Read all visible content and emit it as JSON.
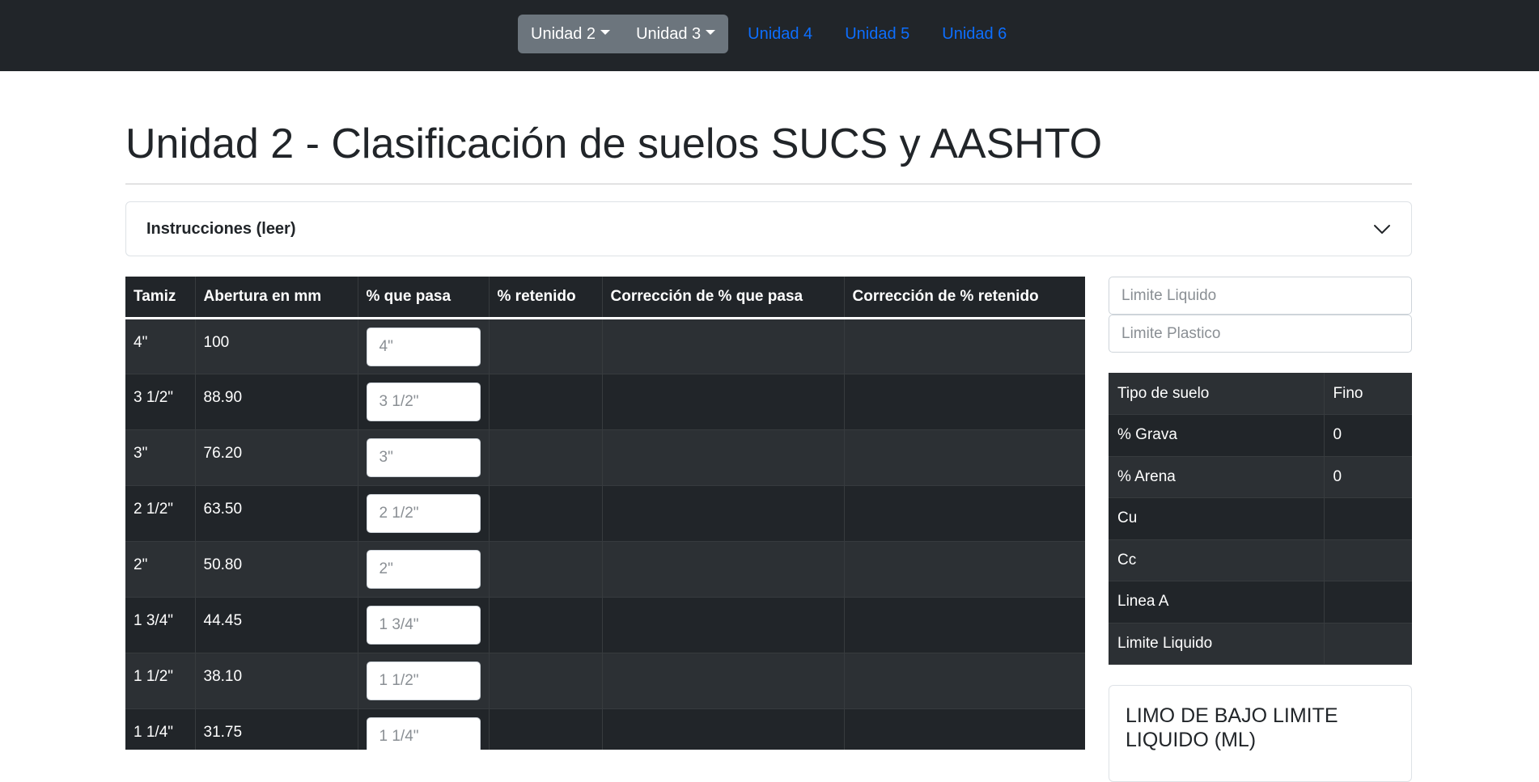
{
  "navbar": {
    "dropdowns": [
      {
        "label": "Unidad 2"
      },
      {
        "label": "Unidad 3"
      }
    ],
    "links": [
      {
        "label": "Unidad 4"
      },
      {
        "label": "Unidad 5"
      },
      {
        "label": "Unidad 6"
      }
    ],
    "colors": {
      "background": "#212529",
      "dropdown": "#6c757d",
      "link": "#0d6efd"
    }
  },
  "page": {
    "title": "Unidad 2 - Clasificación de suelos SUCS y AASHTO"
  },
  "accordion": {
    "label": "Instrucciones (leer)",
    "icon": "chevron-down-icon"
  },
  "sieve_table": {
    "headers": [
      "Tamiz",
      "Abertura en mm",
      "% que pasa",
      "% retenido",
      "Corrección de % que pasa",
      "Corrección de % retenido"
    ],
    "rows": [
      {
        "tamiz": "4\"",
        "abertura": "100",
        "placeholder": "4\"",
        "retenido": "",
        "corr_pasa": "",
        "corr_retenido": ""
      },
      {
        "tamiz": "3 1/2\"",
        "abertura": "88.90",
        "placeholder": "3 1/2\"",
        "retenido": "",
        "corr_pasa": "",
        "corr_retenido": ""
      },
      {
        "tamiz": "3\"",
        "abertura": "76.20",
        "placeholder": "3\"",
        "retenido": "",
        "corr_pasa": "",
        "corr_retenido": ""
      },
      {
        "tamiz": "2 1/2\"",
        "abertura": "63.50",
        "placeholder": "2 1/2\"",
        "retenido": "",
        "corr_pasa": "",
        "corr_retenido": ""
      },
      {
        "tamiz": "2\"",
        "abertura": "50.80",
        "placeholder": "2\"",
        "retenido": "",
        "corr_pasa": "",
        "corr_retenido": ""
      },
      {
        "tamiz": "1 3/4\"",
        "abertura": "44.45",
        "placeholder": "1 3/4\"",
        "retenido": "",
        "corr_pasa": "",
        "corr_retenido": ""
      },
      {
        "tamiz": "1 1/2\"",
        "abertura": "38.10",
        "placeholder": "1 1/2\"",
        "retenido": "",
        "corr_pasa": "",
        "corr_retenido": ""
      },
      {
        "tamiz": "1 1/4\"",
        "abertura": "31.75",
        "placeholder": "1 1/4\"",
        "retenido": "",
        "corr_pasa": "",
        "corr_retenido": ""
      }
    ]
  },
  "limits": {
    "liquido_placeholder": "Limite Liquido",
    "plastico_placeholder": "Limite Plastico"
  },
  "summary": {
    "rows": [
      {
        "label": "Tipo de suelo",
        "value": "Fino"
      },
      {
        "label": "% Grava",
        "value": "0"
      },
      {
        "label": "% Arena",
        "value": "0"
      },
      {
        "label": "Cu",
        "value": ""
      },
      {
        "label": "Cc",
        "value": ""
      },
      {
        "label": "Linea A",
        "value": ""
      },
      {
        "label": "Limite Liquido",
        "value": ""
      }
    ]
  },
  "result": {
    "title": "LIMO DE BAJO LIMITE LIQUIDO (ML)"
  }
}
